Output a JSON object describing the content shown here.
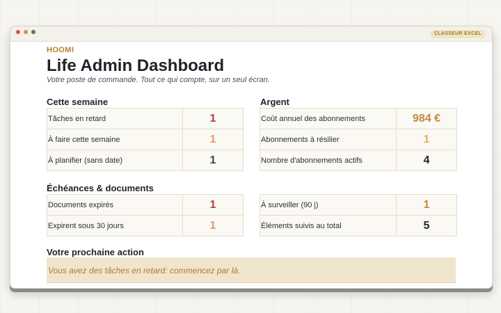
{
  "window": {
    "tag": "CLASSEUR EXCEL"
  },
  "header": {
    "brand": "HOOMI",
    "title": "Life Admin Dashboard",
    "subtitle": "Votre poste de commande. Tout ce qui compte, sur un seul écran."
  },
  "sections": {
    "this_week": {
      "title": "Cette semaine",
      "rows": [
        {
          "label": "Tâches en retard",
          "value": "1"
        },
        {
          "label": "À faire cette semaine",
          "value": "1"
        },
        {
          "label": "À planifier (sans date)",
          "value": "1"
        }
      ]
    },
    "money": {
      "title": "Argent",
      "rows": [
        {
          "label": "Coût annuel des abonnements",
          "value": "984 €"
        },
        {
          "label": "Abonnements à résilier",
          "value": "1"
        },
        {
          "label": "Nombre d'abonnements actifs",
          "value": "4"
        }
      ]
    },
    "deadlines": {
      "title": "Échéances & documents",
      "left_rows": [
        {
          "label": "Documents expirés",
          "value": "1"
        },
        {
          "label": "Expirent sous 30 jours",
          "value": "1"
        }
      ],
      "right_rows": [
        {
          "label": "À surveiller (90 j)",
          "value": "1"
        },
        {
          "label": "Éléments suivis au total",
          "value": "5"
        }
      ]
    },
    "next_action": {
      "title": "Votre prochaine action",
      "text": "Vous avez des tâches en retard: commencez par là."
    }
  },
  "colors": {
    "accent_gold": "#b5822d",
    "overdue_red": "#b0413e",
    "soon_orange": "#e59a6a",
    "action_bg": "#f1e4cc"
  }
}
